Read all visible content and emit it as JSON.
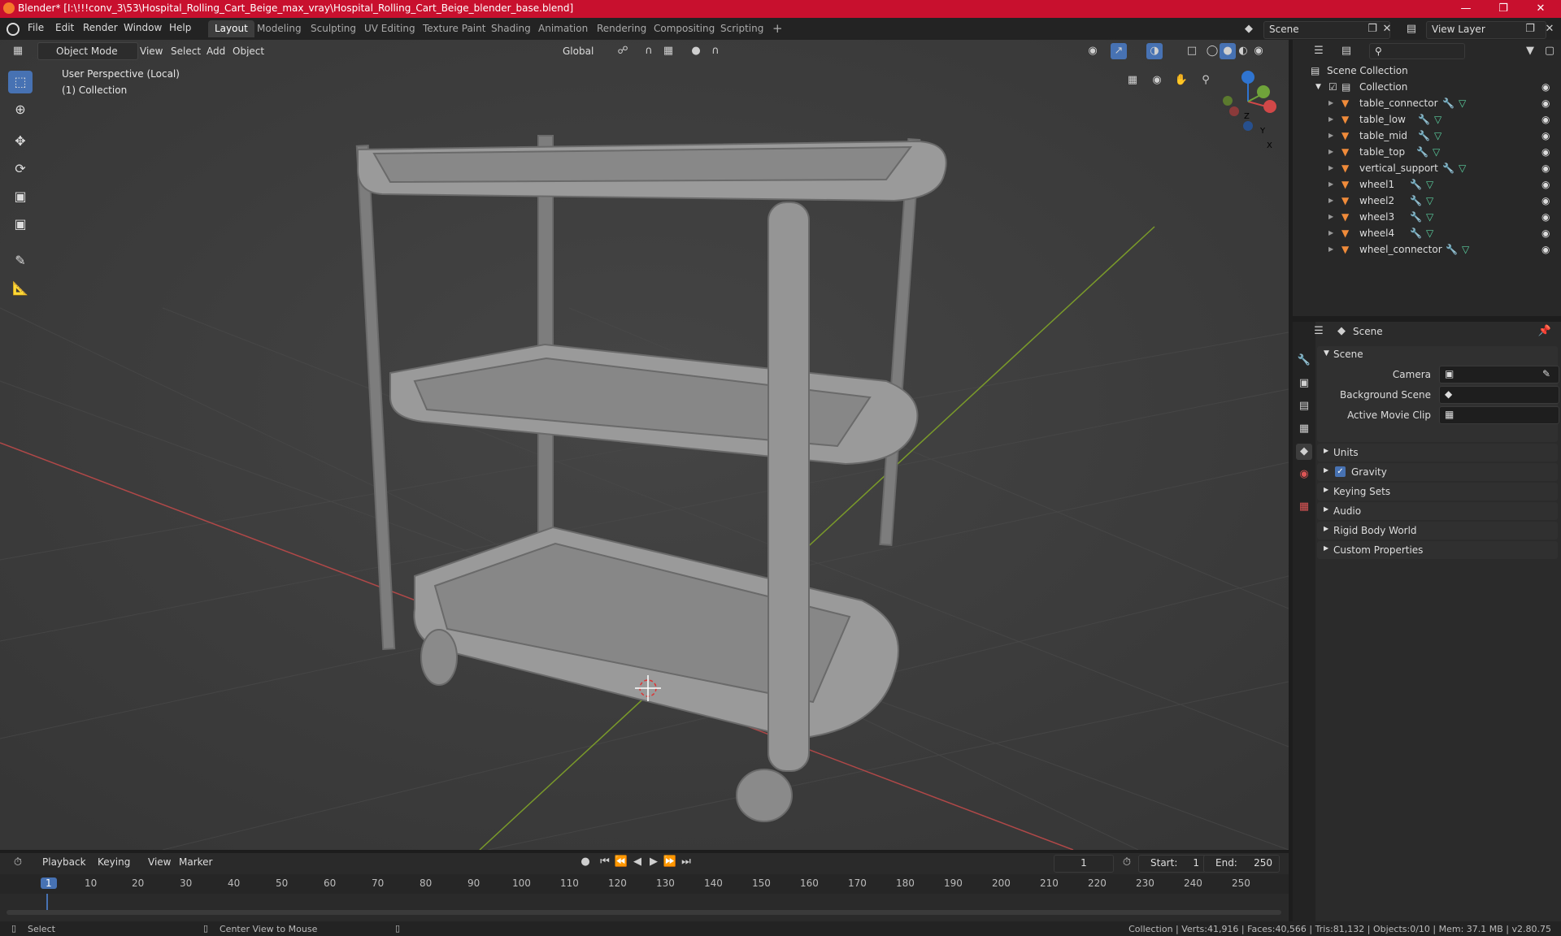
{
  "titlebar": {
    "title": "Blender* [I:\\!!!conv_3\\53\\Hospital_Rolling_Cart_Beige_max_vray\\Hospital_Rolling_Cart_Beige_blender_base.blend]",
    "minimize": "—",
    "maximize": "❐",
    "close": "✕"
  },
  "menubar": {
    "items": [
      "File",
      "Edit",
      "Render",
      "Window",
      "Help"
    ]
  },
  "workspaces": {
    "tabs": [
      "Layout",
      "Modeling",
      "Sculpting",
      "UV Editing",
      "Texture Paint",
      "Shading",
      "Animation",
      "Rendering",
      "Compositing",
      "Scripting"
    ],
    "active": "Layout",
    "add": "+"
  },
  "scene_selector": {
    "label": "Scene"
  },
  "viewlayer_selector": {
    "label": "View Layer"
  },
  "viewport": {
    "mode": "Object Mode",
    "menus": [
      "View",
      "Select",
      "Add",
      "Object"
    ],
    "orientation": "Global",
    "overlay_line1": "User Perspective (Local)",
    "overlay_line2": "(1) Collection",
    "gizmo": {
      "x": "X",
      "y": "Y",
      "z": "Z"
    }
  },
  "outliner": {
    "root": "Scene Collection",
    "collection": "Collection",
    "objects": [
      "table_connector",
      "table_low",
      "table_mid",
      "table_top",
      "vertical_support",
      "wheel1",
      "wheel2",
      "wheel3",
      "wheel4",
      "wheel_connector"
    ]
  },
  "properties": {
    "header": "Scene",
    "panel_title": "Scene",
    "fields": [
      {
        "label": "Camera",
        "value": ""
      },
      {
        "label": "Background Scene",
        "value": ""
      },
      {
        "label": "Active Movie Clip",
        "value": ""
      }
    ],
    "sections": [
      "Units",
      "Gravity",
      "Keying Sets",
      "Audio",
      "Rigid Body World",
      "Custom Properties"
    ],
    "gravity_checked": true
  },
  "timeline": {
    "menus": [
      "Playback",
      "Keying",
      "View",
      "Marker"
    ],
    "current_frame": "1",
    "start_label": "Start:",
    "start": "1",
    "end_label": "End:",
    "end": "250",
    "ticks": [
      "1",
      "10",
      "20",
      "30",
      "40",
      "50",
      "60",
      "70",
      "80",
      "90",
      "100",
      "110",
      "120",
      "130",
      "140",
      "150",
      "160",
      "170",
      "180",
      "190",
      "200",
      "210",
      "220",
      "230",
      "240",
      "250"
    ]
  },
  "statusbar": {
    "left": "Select",
    "middle": "Center View to Mouse",
    "right": "Collection | Verts:41,916 | Faces:40,566 | Tris:81,132 | Objects:0/10 | Mem: 37.1 MB | v2.80.75"
  },
  "colors": {
    "titlebar": "#c8102e",
    "accent": "#4772b3",
    "viewport_bg": "#3d3d3d",
    "x_axis": "#b04848",
    "y_axis": "#7a9a2a"
  }
}
